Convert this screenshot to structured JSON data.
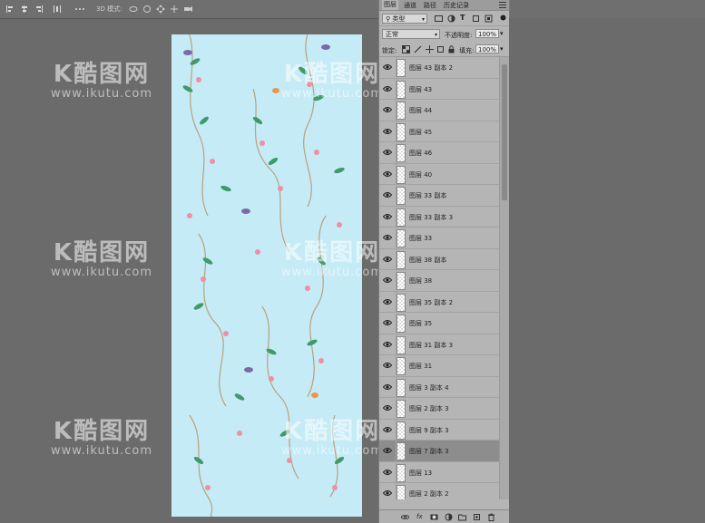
{
  "options_bar": {
    "mode3d_label": "3D 模式:",
    "icons": [
      "align-left-icon",
      "align-center-icon",
      "align-right-icon",
      "distribute-icon",
      "more-icon",
      "orbit-icon",
      "roll-icon",
      "pan-icon",
      "slide-icon",
      "camera-icon"
    ]
  },
  "panel": {
    "tabs": [
      "图层",
      "通道",
      "路径",
      "历史记录"
    ],
    "active_tab": "图层",
    "filter": {
      "value": "类型"
    },
    "blend_mode": {
      "value": "正常"
    },
    "opacity": {
      "label": "不透明度:",
      "value": "100%"
    },
    "lock": {
      "label": "锁定:"
    },
    "fill": {
      "label": "填充:",
      "value": "100%"
    },
    "layers": [
      {
        "name": "图层 43 副本 2",
        "visible": true,
        "selected": false
      },
      {
        "name": "图层 43",
        "visible": true,
        "selected": false
      },
      {
        "name": "图层 44",
        "visible": true,
        "selected": false
      },
      {
        "name": "图层 45",
        "visible": true,
        "selected": false
      },
      {
        "name": "图层 46",
        "visible": true,
        "selected": false
      },
      {
        "name": "图层 40",
        "visible": true,
        "selected": false
      },
      {
        "name": "图层 33 副本",
        "visible": true,
        "selected": false
      },
      {
        "name": "图层 33 副本 3",
        "visible": true,
        "selected": false
      },
      {
        "name": "图层 33",
        "visible": true,
        "selected": false
      },
      {
        "name": "图层 38 副本",
        "visible": true,
        "selected": false
      },
      {
        "name": "图层 38",
        "visible": true,
        "selected": false
      },
      {
        "name": "图层 35 副本 2",
        "visible": true,
        "selected": false
      },
      {
        "name": "图层 35",
        "visible": true,
        "selected": false
      },
      {
        "name": "图层 31 副本 3",
        "visible": true,
        "selected": false
      },
      {
        "name": "图层 31",
        "visible": true,
        "selected": false
      },
      {
        "name": "图层 3 副本 4",
        "visible": true,
        "selected": false
      },
      {
        "name": "图层 2 副本 3",
        "visible": true,
        "selected": false
      },
      {
        "name": "图层 9 副本 3",
        "visible": true,
        "selected": false
      },
      {
        "name": "图层 7 副本 3",
        "visible": true,
        "selected": true
      },
      {
        "name": "图层 13",
        "visible": true,
        "selected": false
      },
      {
        "name": "图层 2 副本 2",
        "visible": true,
        "selected": false
      }
    ],
    "bottom_icons": [
      "link-icon",
      "fx-icon",
      "mask-icon",
      "adjustment-icon",
      "group-icon",
      "new-layer-icon",
      "trash-icon"
    ]
  },
  "watermark": {
    "logo": "K酷图网",
    "url": "www.ikutu.com"
  },
  "colors": {
    "canvas_bg": "#c5ebf7",
    "workspace": "#6b6b6b",
    "panel_bg": "#b5b5b5",
    "selected_layer": "#8d8d8d"
  }
}
